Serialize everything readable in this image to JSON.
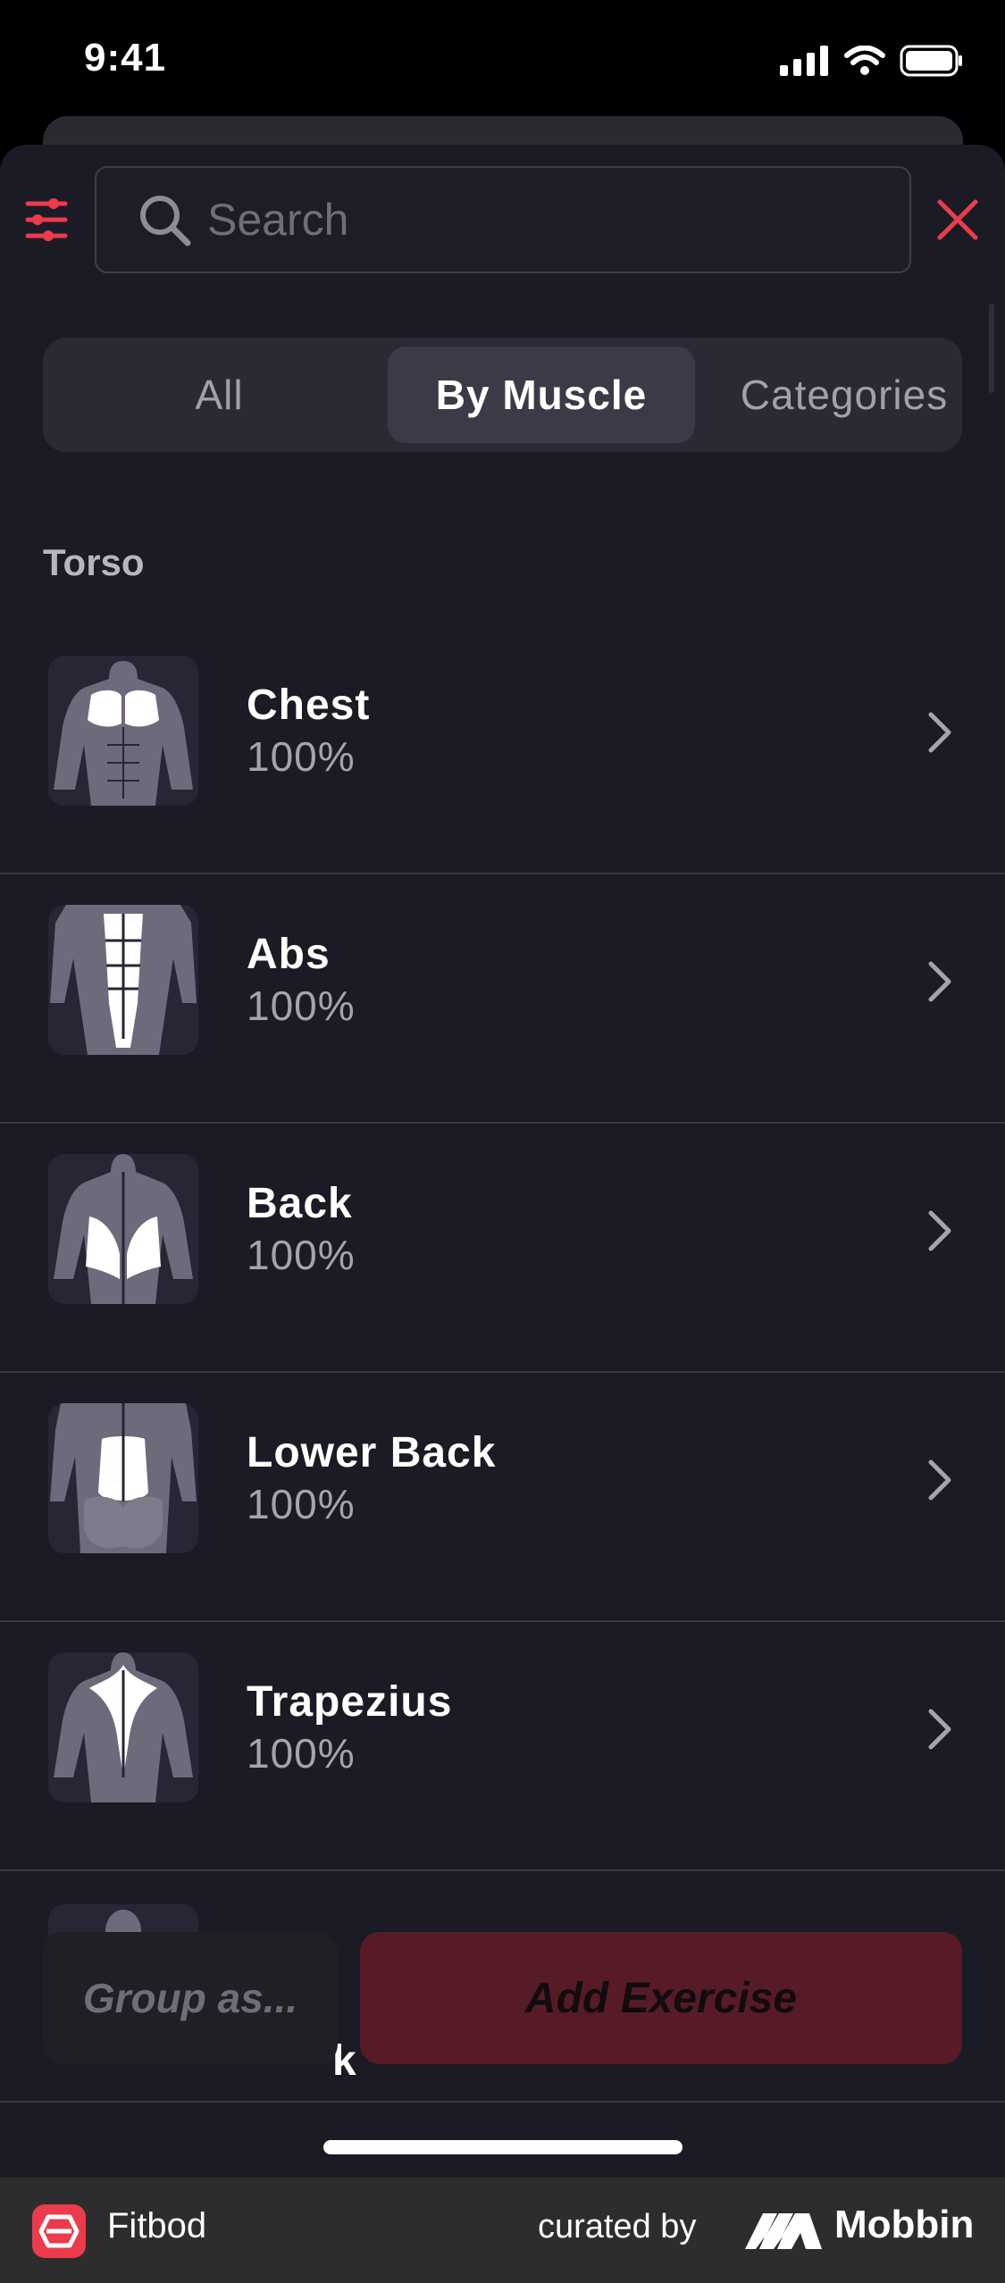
{
  "status_bar": {
    "time": "9:41"
  },
  "search": {
    "placeholder": "Search",
    "value": ""
  },
  "segments": [
    "All",
    "By Muscle",
    "Categories"
  ],
  "selected_segment": "By Muscle",
  "section": {
    "title": "Torso"
  },
  "muscles": [
    {
      "name": "Chest",
      "sub": "100%",
      "icon": "chest-highlight"
    },
    {
      "name": "Abs",
      "sub": "100%",
      "icon": "abs-highlight"
    },
    {
      "name": "Back",
      "sub": "100%",
      "icon": "back-highlight"
    },
    {
      "name": "Lower Back",
      "sub": "100%",
      "icon": "lower-back-highlight"
    },
    {
      "name": "Trapezius",
      "sub": "100%",
      "icon": "trapezius-highlight"
    }
  ],
  "partial_row_text": "k",
  "actions": {
    "group_label": "Group as...",
    "add_label": "Add Exercise"
  },
  "footer": {
    "app_name": "Fitbod",
    "curated_label": "curated by",
    "brand": "Mobbin"
  },
  "colors": {
    "accent": "#ec3b4c",
    "background": "#1b1b25",
    "add_button": "#561b27"
  }
}
